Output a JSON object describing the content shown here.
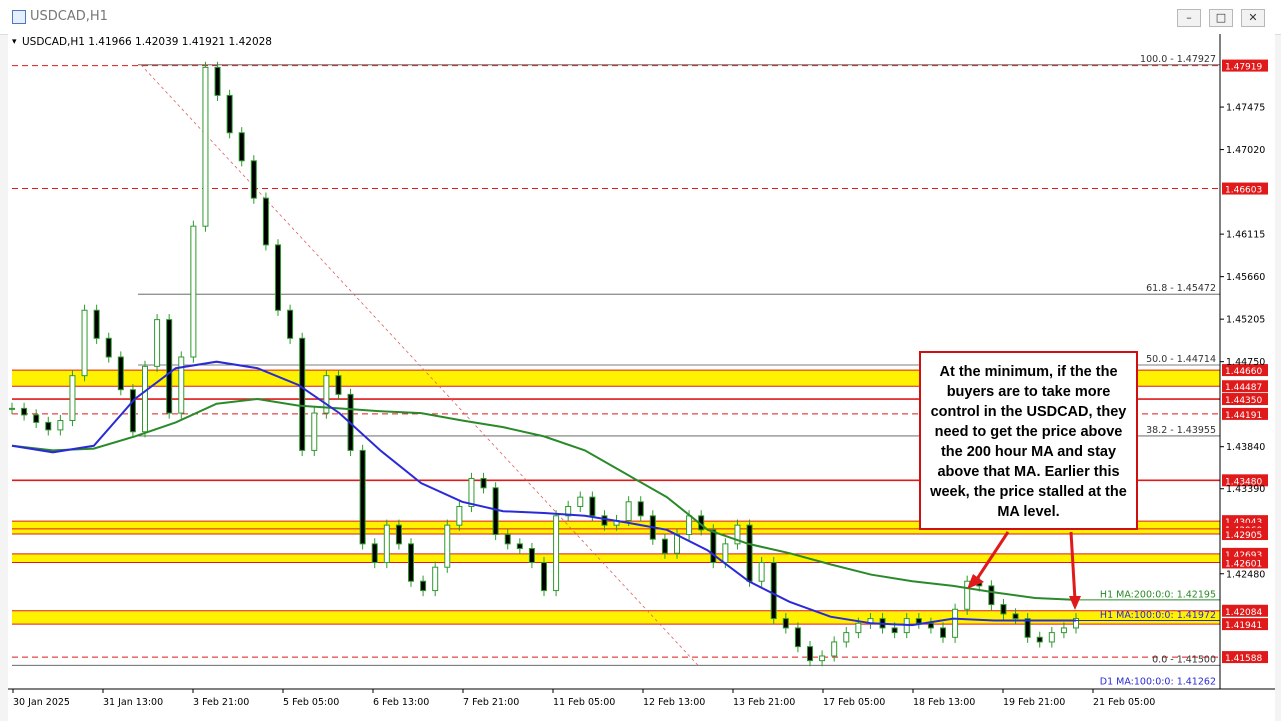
{
  "window": {
    "title": "USDCAD,H1",
    "buttons": [
      "–",
      "□",
      "✕"
    ]
  },
  "chart_header": "USDCAD,H1  1.41966 1.42039 1.41921 1.42028",
  "callout_text": "At the minimum, if the the buyers are to take more control in the USDCAD, they need to get the price above the 200 hour MA and stay above that MA. Earlier this week, the price stalled at the MA level.",
  "colors": {
    "candle": "#2e9a2e",
    "candle_down": "#e01a1a",
    "ma200": "#2a8a2a",
    "ma100": "#2a2ad8",
    "band": "#fff200",
    "level_line": "#e01a1a",
    "fib_line": "#555555"
  },
  "chart_data": {
    "type": "line",
    "symbol": "USDCAD,H1",
    "ylim": [
      1.413,
      1.4815
    ],
    "y_ticks": [
      1.47475,
      1.4702,
      1.46115,
      1.4566,
      1.45205,
      1.4475,
      1.4384,
      1.4339,
      1.4248
    ],
    "x_ticks": [
      "30 Jan 2025",
      "31 Jan 13:00",
      "3 Feb 21:00",
      "5 Feb 05:00",
      "6 Feb 13:00",
      "7 Feb 21:00",
      "11 Feb 05:00",
      "12 Feb 13:00",
      "13 Feb 21:00",
      "17 Feb 05:00",
      "18 Feb 13:00",
      "19 Feb 21:00",
      "21 Feb 05:00"
    ],
    "fib_levels": [
      {
        "label": "100.0 - 1.47927",
        "value": 1.47927
      },
      {
        "label": "61.8 - 1.45472",
        "value": 1.45472
      },
      {
        "label": "50.0 - 1.44714",
        "value": 1.44714
      },
      {
        "label": "38.2 - 1.43955",
        "value": 1.43955
      },
      {
        "label": "0.0 - 1.41500",
        "value": 1.415
      }
    ],
    "price_levels": [
      {
        "label": "1.47919",
        "value": 1.47919
      },
      {
        "label": "1.46603",
        "value": 1.46603
      },
      {
        "label": "1.44660",
        "value": 1.4466
      },
      {
        "label": "1.44487",
        "value": 1.44487
      },
      {
        "label": "1.44350",
        "value": 1.4435
      },
      {
        "label": "1.44191",
        "value": 1.44191
      },
      {
        "label": "1.43480",
        "value": 1.4348
      },
      {
        "label": "1.43043",
        "value": 1.43043
      },
      {
        "label": "1.42960",
        "value": 1.4296
      },
      {
        "label": "1.42905",
        "value": 1.42905
      },
      {
        "label": "1.42693",
        "value": 1.42693
      },
      {
        "label": "1.42601",
        "value": 1.42601
      },
      {
        "label": "1.42084",
        "value": 1.42084
      },
      {
        "label": "1.41941",
        "value": 1.41941
      },
      {
        "label": "1.41588",
        "value": 1.41588
      }
    ],
    "bands": [
      {
        "from": 1.44487,
        "to": 1.4466
      },
      {
        "from": 1.42905,
        "to": 1.43043
      },
      {
        "from": 1.42601,
        "to": 1.42693
      },
      {
        "from": 1.41941,
        "to": 1.42084
      }
    ],
    "ma_labels": [
      {
        "label": "H1 MA:200:0:0: 1.42195",
        "value": 1.42195
      },
      {
        "label": "H1 MA:100:0:0: 1.41972",
        "value": 1.41972
      },
      {
        "label": "D1 MA:100:0:0: 1.41262",
        "value": 1.41262
      }
    ],
    "price_series": [
      1.4425,
      1.4418,
      1.441,
      1.4402,
      1.4412,
      1.446,
      1.453,
      1.45,
      1.448,
      1.4445,
      1.44,
      1.447,
      1.452,
      1.442,
      1.448,
      1.462,
      1.479,
      1.476,
      1.472,
      1.469,
      1.465,
      1.46,
      1.453,
      1.45,
      1.438,
      1.442,
      1.446,
      1.444,
      1.438,
      1.428,
      1.426,
      1.43,
      1.428,
      1.424,
      1.423,
      1.4255,
      1.43,
      1.432,
      1.435,
      1.434,
      1.429,
      1.428,
      1.4275,
      1.426,
      1.423,
      1.431,
      1.432,
      1.433,
      1.431,
      1.43,
      1.4305,
      1.4325,
      1.431,
      1.4285,
      1.427,
      1.429,
      1.431,
      1.4295,
      1.426,
      1.428,
      1.43,
      1.424,
      1.426,
      1.42,
      1.419,
      1.417,
      1.4155,
      1.416,
      1.4175,
      1.4185,
      1.4195,
      1.42,
      1.419,
      1.4185,
      1.42,
      1.4195,
      1.419,
      1.418,
      1.421,
      1.424,
      1.4235,
      1.4215,
      1.4205,
      1.42,
      1.418,
      1.4175,
      1.4185,
      1.419,
      1.42
    ],
    "ma200_series": [
      1.4385,
      1.438,
      1.4382,
      1.4395,
      1.441,
      1.443,
      1.4435,
      1.4428,
      1.4425,
      1.4422,
      1.442,
      1.4412,
      1.4405,
      1.4395,
      1.438,
      1.4355,
      1.433,
      1.4295,
      1.428,
      1.427,
      1.4258,
      1.4247,
      1.424,
      1.4235,
      1.4228,
      1.4222,
      1.422
    ],
    "ma100_series": [
      1.4385,
      1.4378,
      1.4385,
      1.4435,
      1.4468,
      1.4475,
      1.4468,
      1.445,
      1.442,
      1.438,
      1.4345,
      1.4325,
      1.4315,
      1.4313,
      1.431,
      1.4303,
      1.4295,
      1.4273,
      1.424,
      1.4218,
      1.4202,
      1.4195,
      1.4193,
      1.42,
      1.4198,
      1.4198,
      1.4198
    ]
  }
}
